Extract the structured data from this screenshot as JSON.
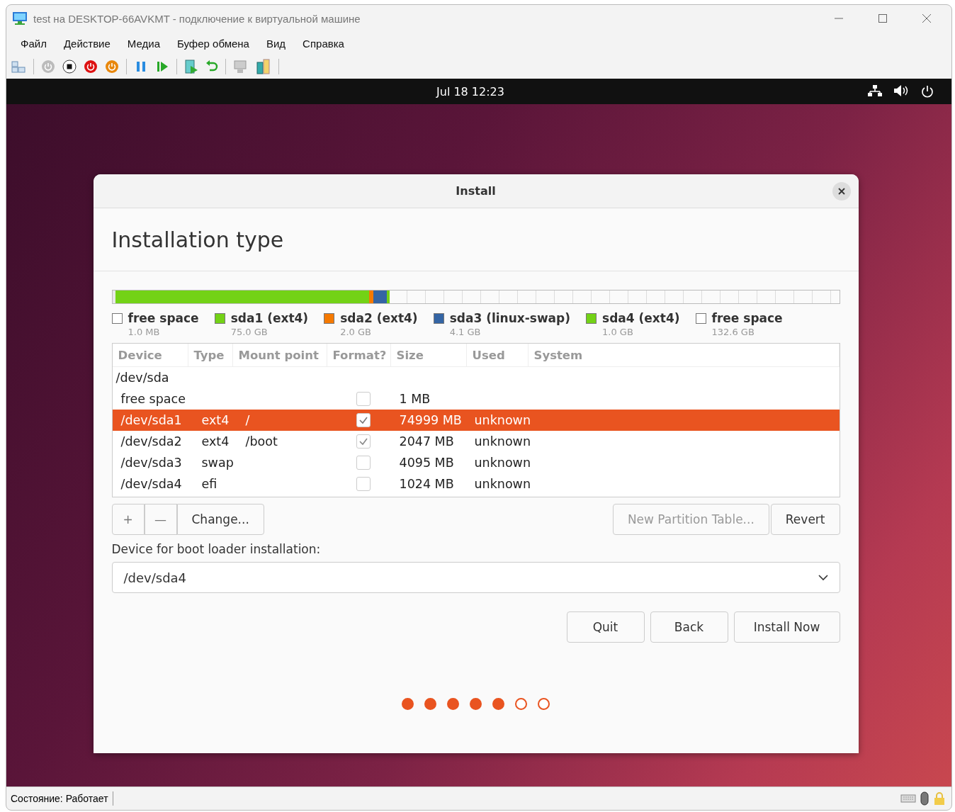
{
  "window": {
    "title": "test на DESKTOP-66AVKMT - подключение к виртуальной машине"
  },
  "menu": [
    "Файл",
    "Действие",
    "Медиа",
    "Буфер обмена",
    "Вид",
    "Справка"
  ],
  "top_bar": {
    "clock": "Jul 18  12:23"
  },
  "dialog": {
    "title": "Install",
    "heading": "Installation type",
    "legend": [
      {
        "name": "free space",
        "size": "1.0 MB",
        "color": "#ffffff"
      },
      {
        "name": "sda1 (ext4)",
        "size": "75.0 GB",
        "color": "#73d216"
      },
      {
        "name": "sda2 (ext4)",
        "size": "2.0 GB",
        "color": "#f57900"
      },
      {
        "name": "sda3 (linux-swap)",
        "size": "4.1 GB",
        "color": "#3465a4"
      },
      {
        "name": "sda4 (ext4)",
        "size": "1.0 GB",
        "color": "#73d216"
      },
      {
        "name": "free space",
        "size": "132.6 GB",
        "color": "#ffffff"
      }
    ],
    "table": {
      "columns": [
        "Device",
        "Type",
        "Mount point",
        "Format?",
        "Size",
        "Used",
        "System"
      ],
      "rows": [
        {
          "kind": "disk",
          "device": "/dev/sda",
          "selected": false
        },
        {
          "kind": "partition",
          "device": "free space",
          "type": "",
          "mount": "",
          "format": false,
          "size": "1 MB",
          "used": "",
          "selected": false
        },
        {
          "kind": "partition",
          "device": "/dev/sda1",
          "type": "ext4",
          "mount": "/",
          "format": true,
          "size": "74999 MB",
          "used": "unknown",
          "selected": true
        },
        {
          "kind": "partition",
          "device": "/dev/sda2",
          "type": "ext4",
          "mount": "/boot",
          "format": true,
          "size": "2047 MB",
          "used": "unknown",
          "selected": false
        },
        {
          "kind": "partition",
          "device": "/dev/sda3",
          "type": "swap",
          "mount": "",
          "format": false,
          "size": "4095 MB",
          "used": "unknown",
          "selected": false
        },
        {
          "kind": "partition",
          "device": "/dev/sda4",
          "type": "efi",
          "mount": "",
          "format": false,
          "size": "1024 MB",
          "used": "unknown",
          "selected": false
        }
      ]
    },
    "add_button": "+",
    "remove_button": "—",
    "change_button": "Change...",
    "new_table_button": {
      "label": "New Partition Table...",
      "disabled": true
    },
    "revert_button": "Revert",
    "boot_loader": {
      "label": "Device for boot loader installation:",
      "value": "/dev/sda4"
    },
    "buttons": [
      "Quit",
      "Back",
      "Install Now"
    ],
    "progress": [
      {
        "done": true
      },
      {
        "done": true
      },
      {
        "done": true
      },
      {
        "done": true
      },
      {
        "done": true
      },
      {
        "done": false
      },
      {
        "done": false
      }
    ]
  },
  "status_bar": {
    "text": "Состояние: Работает"
  }
}
